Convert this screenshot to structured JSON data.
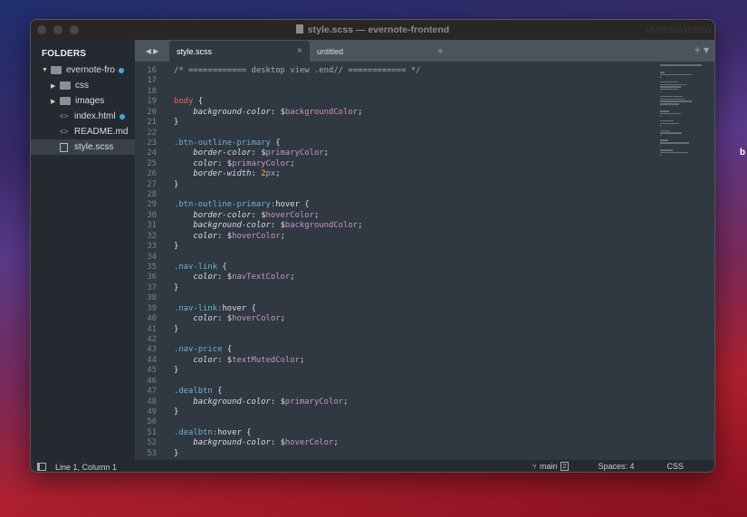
{
  "window": {
    "title": "style.scss — evernote-frontend",
    "unregistered": "UNREGISTERED"
  },
  "sidebar": {
    "heading": "FOLDERS",
    "items": [
      {
        "label": "evernote-fro",
        "type": "folder-open",
        "depth": 0,
        "dot": true
      },
      {
        "label": "css",
        "type": "folder",
        "depth": 1
      },
      {
        "label": "images",
        "type": "folder",
        "depth": 1
      },
      {
        "label": "index.html",
        "type": "code",
        "depth": 1,
        "dot": true
      },
      {
        "label": "README.md",
        "type": "code",
        "depth": 1
      },
      {
        "label": "style.scss",
        "type": "file",
        "depth": 1,
        "selected": true
      }
    ]
  },
  "tabs": [
    {
      "label": "style.scss",
      "active": true,
      "close": "×"
    },
    {
      "label": "untitled",
      "modified": true
    }
  ],
  "tab_controls": {
    "add": "+",
    "menu": "▾"
  },
  "code": [
    {
      "n": 16,
      "t": [
        [
          "/* ============ desktop view .end// ============ */",
          "com"
        ]
      ]
    },
    {
      "n": 17,
      "t": []
    },
    {
      "n": 18,
      "t": []
    },
    {
      "n": 19,
      "t": [
        [
          "body",
          "tag"
        ],
        [
          " {",
          "pun"
        ]
      ]
    },
    {
      "n": 20,
      "t": [
        [
          "    background-color",
          "prop"
        ],
        [
          ": ",
          "pun"
        ],
        [
          "$",
          "txt"
        ],
        [
          "backgroundColor",
          "var"
        ],
        [
          ";",
          "pun"
        ]
      ]
    },
    {
      "n": 21,
      "t": [
        [
          "}",
          "pun"
        ]
      ]
    },
    {
      "n": 22,
      "t": []
    },
    {
      "n": 23,
      "t": [
        [
          ".btn-outline-primary",
          "cls"
        ],
        [
          " {",
          "pun"
        ]
      ]
    },
    {
      "n": 24,
      "t": [
        [
          "    border-color",
          "prop"
        ],
        [
          ": ",
          "pun"
        ],
        [
          "$",
          "txt"
        ],
        [
          "primaryColor",
          "var"
        ],
        [
          ";",
          "pun"
        ]
      ]
    },
    {
      "n": 25,
      "t": [
        [
          "    color",
          "prop"
        ],
        [
          ": ",
          "pun"
        ],
        [
          "$",
          "txt"
        ],
        [
          "primaryColor",
          "var"
        ],
        [
          ";",
          "pun"
        ]
      ]
    },
    {
      "n": 26,
      "t": [
        [
          "    border-width",
          "prop"
        ],
        [
          ": ",
          "pun"
        ],
        [
          "2",
          "num"
        ],
        [
          "px",
          "unit"
        ],
        [
          ";",
          "pun"
        ]
      ]
    },
    {
      "n": 27,
      "t": [
        [
          "}",
          "pun"
        ]
      ]
    },
    {
      "n": 28,
      "t": []
    },
    {
      "n": 29,
      "t": [
        [
          ".btn-outline-primary",
          "cls"
        ],
        [
          ":",
          "pc"
        ],
        [
          "hover",
          "txt"
        ],
        [
          " {",
          "pun"
        ]
      ]
    },
    {
      "n": 30,
      "t": [
        [
          "    border-color",
          "prop"
        ],
        [
          ": ",
          "pun"
        ],
        [
          "$",
          "txt"
        ],
        [
          "hoverColor",
          "var"
        ],
        [
          ";",
          "pun"
        ]
      ]
    },
    {
      "n": 31,
      "t": [
        [
          "    background-color",
          "prop"
        ],
        [
          ": ",
          "pun"
        ],
        [
          "$",
          "txt"
        ],
        [
          "backgroundColor",
          "var"
        ],
        [
          ";",
          "pun"
        ]
      ]
    },
    {
      "n": 32,
      "t": [
        [
          "    color",
          "prop"
        ],
        [
          ": ",
          "pun"
        ],
        [
          "$",
          "txt"
        ],
        [
          "hoverColor",
          "var"
        ],
        [
          ";",
          "pun"
        ]
      ]
    },
    {
      "n": 33,
      "t": [
        [
          "}",
          "pun"
        ]
      ]
    },
    {
      "n": 34,
      "t": []
    },
    {
      "n": 35,
      "t": [
        [
          ".nav-link",
          "cls"
        ],
        [
          " {",
          "pun"
        ]
      ]
    },
    {
      "n": 36,
      "t": [
        [
          "    color",
          "prop"
        ],
        [
          ": ",
          "pun"
        ],
        [
          "$",
          "txt"
        ],
        [
          "navTextColor",
          "var"
        ],
        [
          ";",
          "pun"
        ]
      ]
    },
    {
      "n": 37,
      "t": [
        [
          "}",
          "pun"
        ]
      ]
    },
    {
      "n": 38,
      "t": []
    },
    {
      "n": 39,
      "t": [
        [
          ".nav-link",
          "cls"
        ],
        [
          ":",
          "pc"
        ],
        [
          "hover",
          "txt"
        ],
        [
          " {",
          "pun"
        ]
      ]
    },
    {
      "n": 40,
      "t": [
        [
          "    color",
          "prop"
        ],
        [
          ": ",
          "pun"
        ],
        [
          "$",
          "txt"
        ],
        [
          "hoverColor",
          "var"
        ],
        [
          ";",
          "pun"
        ]
      ]
    },
    {
      "n": 41,
      "t": [
        [
          "}",
          "pun"
        ]
      ]
    },
    {
      "n": 42,
      "t": []
    },
    {
      "n": 43,
      "t": [
        [
          ".nav-price",
          "cls"
        ],
        [
          " {",
          "pun"
        ]
      ]
    },
    {
      "n": 44,
      "t": [
        [
          "    color",
          "prop"
        ],
        [
          ": ",
          "pun"
        ],
        [
          "$",
          "txt"
        ],
        [
          "textMutedColor",
          "var"
        ],
        [
          ";",
          "pun"
        ]
      ]
    },
    {
      "n": 45,
      "t": [
        [
          "}",
          "pun"
        ]
      ]
    },
    {
      "n": 46,
      "t": []
    },
    {
      "n": 47,
      "t": [
        [
          ".dealbtn",
          "cls"
        ],
        [
          " {",
          "pun"
        ]
      ]
    },
    {
      "n": 48,
      "t": [
        [
          "    background-color",
          "prop"
        ],
        [
          ": ",
          "pun"
        ],
        [
          "$",
          "txt"
        ],
        [
          "primaryColor",
          "var"
        ],
        [
          ";",
          "pun"
        ]
      ]
    },
    {
      "n": 49,
      "t": [
        [
          "}",
          "pun"
        ]
      ]
    },
    {
      "n": 50,
      "t": []
    },
    {
      "n": 51,
      "t": [
        [
          ".dealbtn",
          "cls"
        ],
        [
          ":",
          "pc"
        ],
        [
          "hover",
          "txt"
        ],
        [
          " {",
          "pun"
        ]
      ]
    },
    {
      "n": 52,
      "t": [
        [
          "    background-color",
          "prop"
        ],
        [
          ": ",
          "pun"
        ],
        [
          "$",
          "txt"
        ],
        [
          "hoverColor",
          "var"
        ],
        [
          ";",
          "pun"
        ]
      ]
    },
    {
      "n": 53,
      "t": [
        [
          "}",
          "pun"
        ]
      ]
    }
  ],
  "status": {
    "position": "Line 1, Column 1",
    "branch": "main",
    "branch_changes": "2",
    "indent": "Spaces: 4",
    "syntax": "CSS"
  }
}
